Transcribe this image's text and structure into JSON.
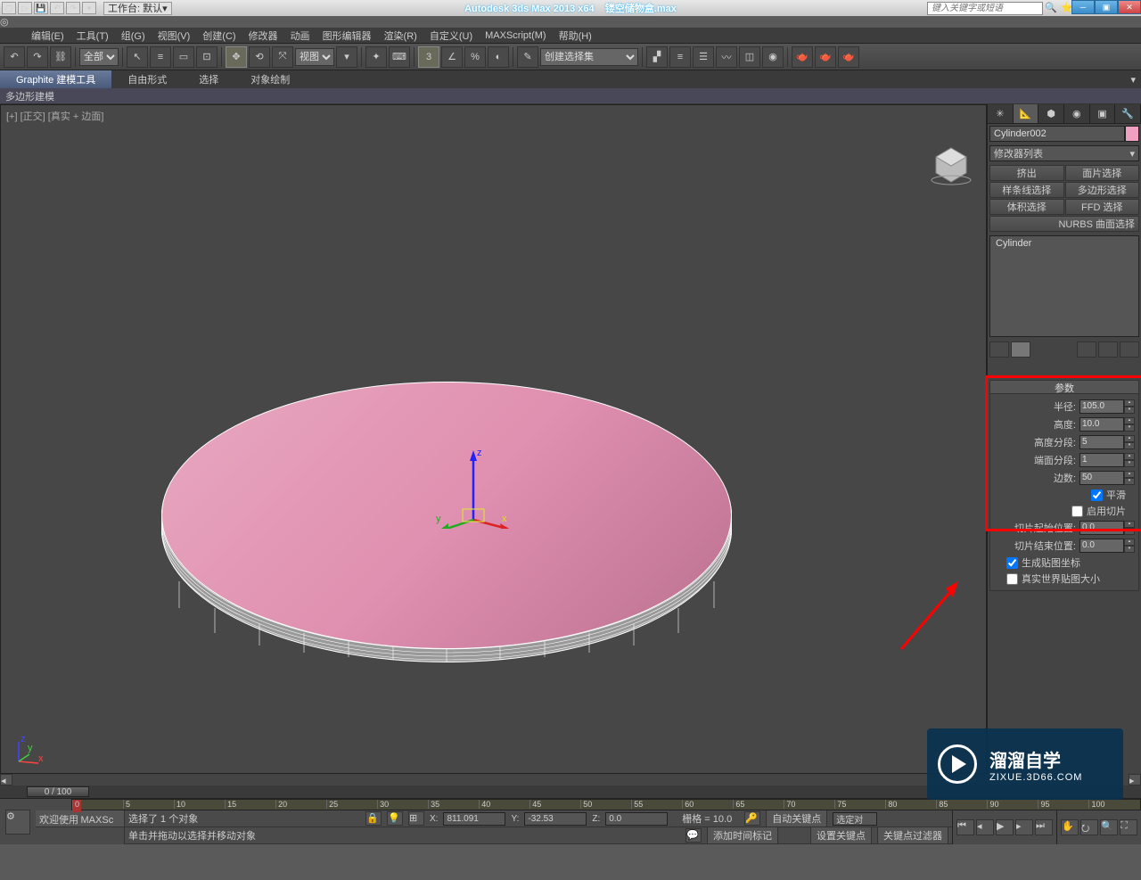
{
  "titlebar": {
    "workspace_label": "工作台: 默认",
    "app_title": "Autodesk 3ds Max  2013 x64",
    "filename": "镂空储物盒.max",
    "search_placeholder": "键入关键字或短语"
  },
  "menu": {
    "items": [
      "编辑(E)",
      "工具(T)",
      "组(G)",
      "视图(V)",
      "创建(C)",
      "修改器",
      "动画",
      "图形编辑器",
      "渲染(R)",
      "自定义(U)",
      "MAXScript(M)",
      "帮助(H)"
    ]
  },
  "main_toolbar": {
    "filter_all": "全部",
    "view_dropdown": "视图",
    "selection_set": "创建选择集"
  },
  "ribbon": {
    "tabs": [
      "Graphite 建模工具",
      "自由形式",
      "选择",
      "对象绘制"
    ],
    "sub": "多边形建模"
  },
  "viewport": {
    "label": "[+] [正交] [真实 + 边面]"
  },
  "cmd": {
    "tab_icons": [
      "✳",
      "↗",
      "⬢",
      "◉",
      "▣",
      "🔧"
    ],
    "object_name": "Cylinder002",
    "modifier_list_label": "修改器列表",
    "mod_buttons": [
      "挤出",
      "面片选择",
      "样条线选择",
      "多边形选择",
      "体积选择",
      "FFD 选择"
    ],
    "nurbs_label": "NURBS 曲面选择",
    "stack_item": "Cylinder"
  },
  "params": {
    "header": "参数",
    "radius_label": "半径:",
    "radius_value": "105.0",
    "height_label": "高度:",
    "height_value": "10.0",
    "hseg_label": "高度分段:",
    "hseg_value": "5",
    "cseg_label": "端面分段:",
    "cseg_value": "1",
    "sides_label": "边数:",
    "sides_value": "50",
    "smooth_label": "平滑",
    "slice_on_label": "启用切片",
    "slice_from_label": "切片起始位置:",
    "slice_from_value": "0.0",
    "slice_to_label": "切片结束位置:",
    "slice_to_value": "0.0",
    "gen_uv_label": "生成贴图坐标",
    "real_world_label": "真实世界贴图大小"
  },
  "timeline": {
    "slider_text": "0 / 100",
    "ticks": [
      "0",
      "5",
      "10",
      "15",
      "20",
      "25",
      "30",
      "35",
      "40",
      "45",
      "50",
      "55",
      "60",
      "65",
      "70",
      "75",
      "80",
      "85",
      "90",
      "95",
      "100"
    ]
  },
  "status": {
    "welcome": "欢迎使用",
    "maxscr": "MAXSc",
    "sel_text": "选择了 1 个对象",
    "prompt": "单击并拖动以选择并移动对象",
    "x_label": "X:",
    "x_val": "811.091",
    "y_label": "Y:",
    "y_val": "-32.53",
    "z_label": "Z:",
    "z_val": "0.0",
    "grid_label": "栅格 = 10.0",
    "add_time_tag": "添加时间标记",
    "auto_key": "自动关键点",
    "set_key": "设置关键点",
    "sel_set": "选定对",
    "key_filter": "关键点过滤器"
  },
  "watermark": {
    "cn": "溜溜自学",
    "en": "ZIXUE.3D66.COM"
  },
  "gizmo": {
    "x": "x",
    "y": "y",
    "z": "z"
  }
}
